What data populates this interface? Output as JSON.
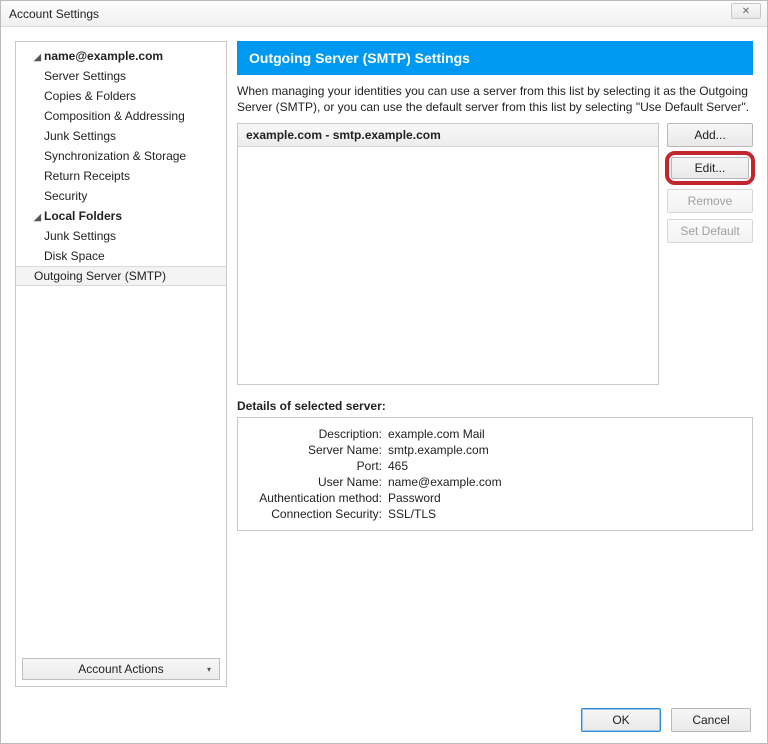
{
  "window": {
    "title": "Account Settings",
    "close_glyph": "✕"
  },
  "sidebar": {
    "account_name": "name@example.com",
    "account_items": [
      "Server Settings",
      "Copies & Folders",
      "Composition & Addressing",
      "Junk Settings",
      "Synchronization & Storage",
      "Return Receipts",
      "Security"
    ],
    "local_folders_label": "Local Folders",
    "local_items": [
      "Junk Settings",
      "Disk Space"
    ],
    "outgoing_label": "Outgoing Server (SMTP)",
    "account_actions_label": "Account Actions"
  },
  "main": {
    "header": "Outgoing Server (SMTP) Settings",
    "intro": "When managing your identities you can use a server from this list by selecting it as the Outgoing Server (SMTP), or you can use the default server from this list by selecting \"Use Default Server\".",
    "server_item": "example.com - smtp.example.com",
    "buttons": {
      "add": "Add...",
      "edit": "Edit...",
      "remove": "Remove",
      "set_default": "Set Default"
    },
    "details_title": "Details of selected server:",
    "details": {
      "description_label": "Description:",
      "description_value": "example.com Mail",
      "server_name_label": "Server Name:",
      "server_name_value": "smtp.example.com",
      "port_label": "Port:",
      "port_value": "465",
      "user_name_label": "User Name:",
      "user_name_value": "name@example.com",
      "auth_label": "Authentication method:",
      "auth_value": "Password",
      "conn_label": "Connection Security:",
      "conn_value": "SSL/TLS"
    }
  },
  "footer": {
    "ok": "OK",
    "cancel": "Cancel"
  }
}
